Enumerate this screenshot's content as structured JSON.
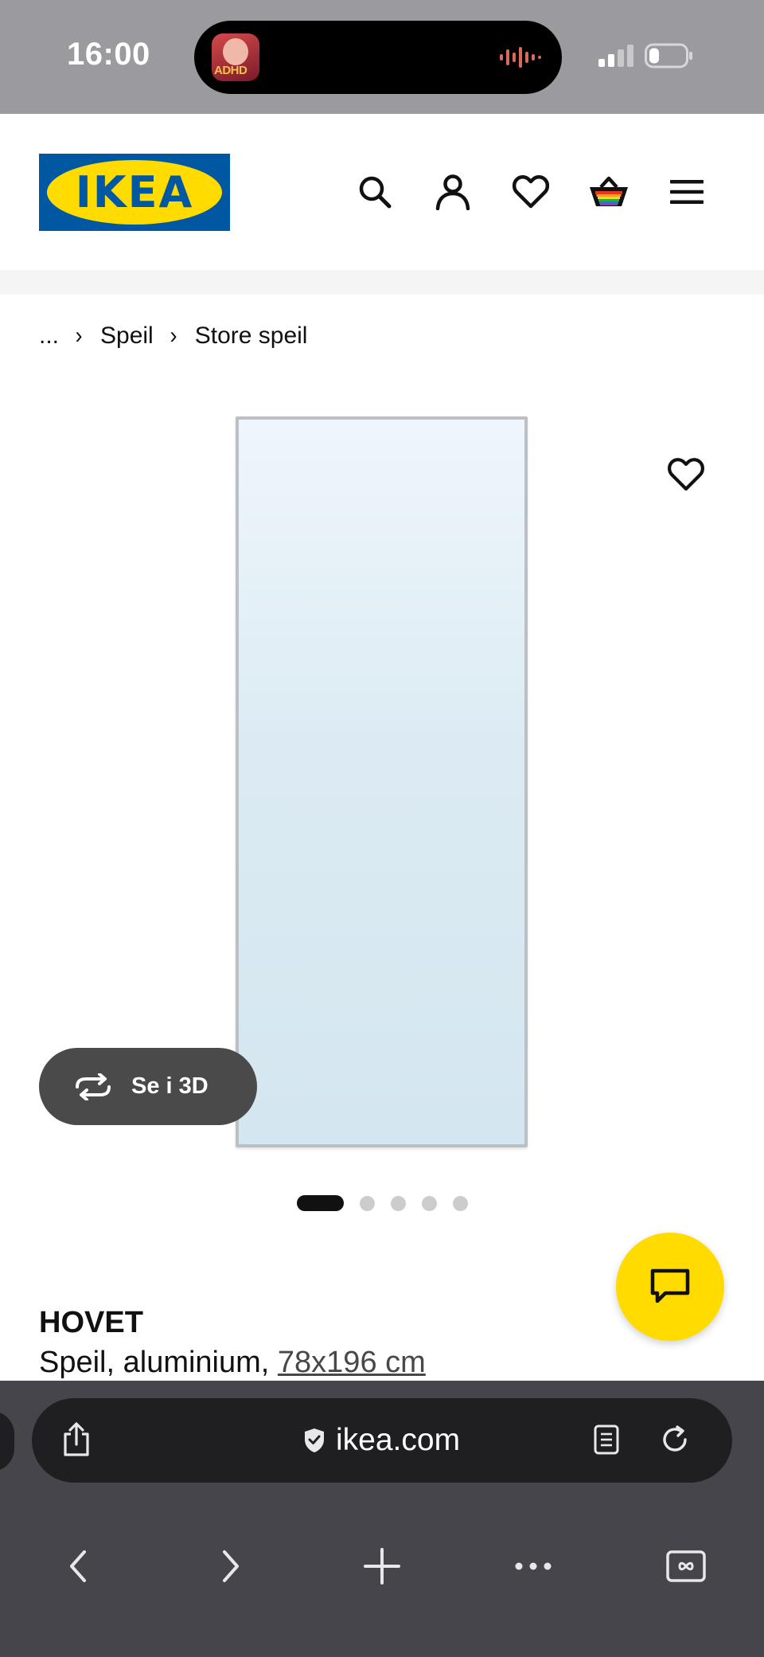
{
  "status_bar": {
    "time": "16:00",
    "live_activity_app_label": "ADHD"
  },
  "header": {
    "logo_text": "IKEA",
    "brand_colors": {
      "blue": "#0058a3",
      "yellow": "#ffdb00"
    },
    "icons": [
      "search-icon",
      "account-icon",
      "heart-icon",
      "basket-icon",
      "menu-icon"
    ]
  },
  "breadcrumb": {
    "ellipsis": "...",
    "items": [
      "Speil",
      "Store speil"
    ]
  },
  "gallery": {
    "see_3d_label": "Se i 3D",
    "image_count": 5,
    "active_index": 0
  },
  "product": {
    "name": "HOVET",
    "description": "Speil, aluminium, ",
    "size": "78x196 cm"
  },
  "browser": {
    "url": "ikea.com",
    "icons": [
      "share-icon",
      "shield-icon",
      "reader-icon",
      "reload-icon",
      "back-icon",
      "forward-icon",
      "new-tab-icon",
      "more-icon",
      "tabs-icon"
    ]
  }
}
